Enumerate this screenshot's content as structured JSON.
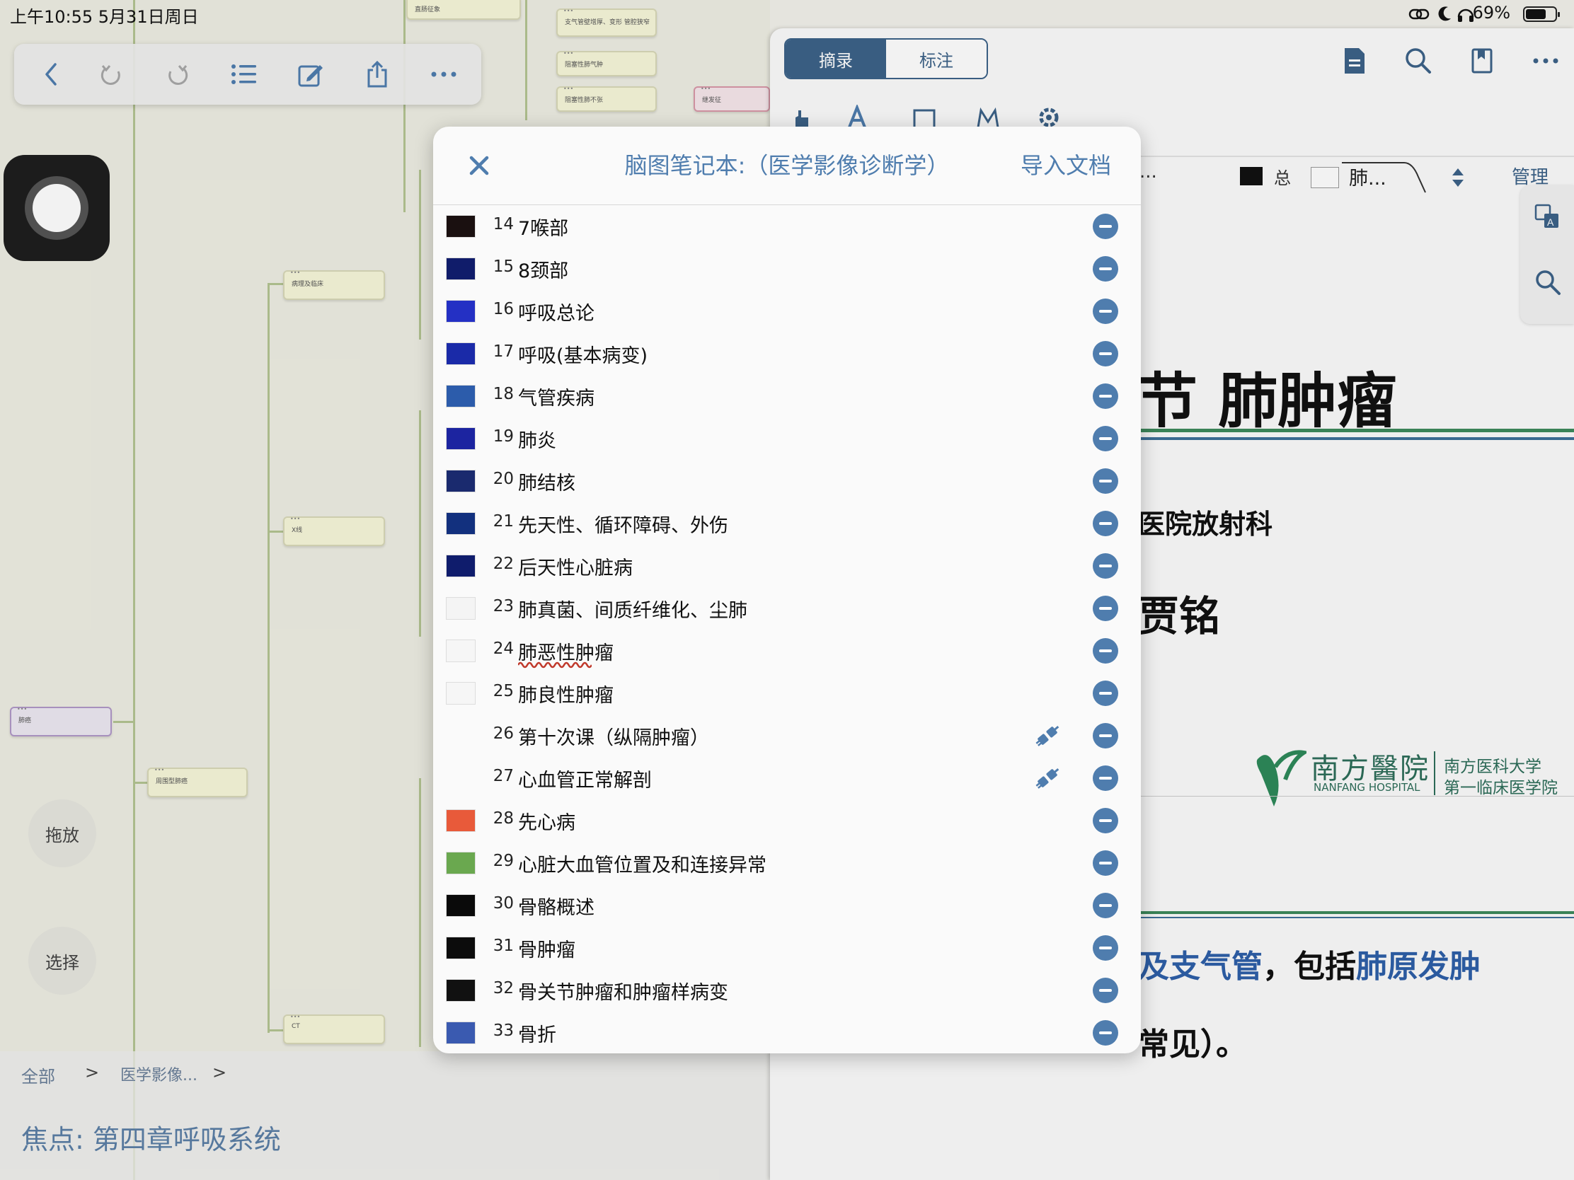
{
  "status_bar": {
    "time": "上午10:55  5月31日周日",
    "battery": "69%",
    "battery_level": 0.69
  },
  "left_pane": {
    "nodes": [
      "直肠征象",
      "支气管壁增厚、变形 管腔狭窄",
      "阻塞性肺气肿",
      "阻塞性肺不张",
      "继发征",
      "病理及临床",
      "X线",
      "肺癌",
      "周围型肺癌",
      "CT"
    ],
    "buttons": {
      "drag": "拖放",
      "select": "选择"
    },
    "breadcrumb": {
      "root": "全部",
      "sep1": ">",
      "item": "医学影像...",
      "sep2": ">"
    },
    "focus": "焦点:  第四章呼吸系统"
  },
  "right_pane": {
    "tabs": {
      "excerpt": "摘录",
      "annotate": "标注"
    },
    "doc_tabs": {
      "tab1": "...",
      "tab2": "总",
      "tab3": "肺...",
      "manage": "管理"
    },
    "doc": {
      "title": "节 肺肿瘤",
      "dept": "医院放射科",
      "author": "贾铭",
      "hospital_cn": "南方醫院",
      "hospital_en": "NANFANG HOSPITAL",
      "school_line1": "南方医科大学",
      "school_line2": "第一临床医学院",
      "body1_a": "及支气管",
      "body1_b": "，包括",
      "body1_c": "肺原发肿",
      "body2": "常见）。"
    },
    "colors": {
      "accent": "#3d6288",
      "green_rule": "#3e8a5c",
      "blue_rule": "#3e6f98"
    }
  },
  "modal": {
    "close_icon": "close-icon",
    "title": "脑图笔记本:（医学影像诊断学）",
    "import": "导入文档",
    "items": [
      {
        "num": "14",
        "label": "7喉部",
        "thumb": "#1a1010",
        "pinned": false
      },
      {
        "num": "15",
        "label": "8颈部",
        "thumb": "#101c6a",
        "pinned": false
      },
      {
        "num": "16",
        "label": "呼吸总论",
        "thumb": "#2430c4",
        "pinned": false
      },
      {
        "num": "17",
        "label": "呼吸(基本病变)",
        "thumb": "#1a2aa8",
        "pinned": false
      },
      {
        "num": "18",
        "label": "气管疾病",
        "thumb": "#2c5cab",
        "pinned": false
      },
      {
        "num": "19",
        "label": "肺炎",
        "thumb": "#1c24a0",
        "pinned": false
      },
      {
        "num": "20",
        "label": "肺结核",
        "thumb": "#1a2a6e",
        "pinned": false
      },
      {
        "num": "21",
        "label": "先天性、循环障碍、外伤",
        "thumb": "#12307e",
        "pinned": false
      },
      {
        "num": "22",
        "label": "后天性心脏病",
        "thumb": "#0f1c6c",
        "pinned": false
      },
      {
        "num": "23",
        "label": "肺真菌、间质纤维化、尘肺",
        "thumb": "#f4f4f4",
        "pinned": false
      },
      {
        "num": "24",
        "label": "肺恶性肿瘤",
        "thumb": "#f6f6f6",
        "pinned": false,
        "current": true
      },
      {
        "num": "25",
        "label": "肺良性肿瘤",
        "thumb": "#f6f6f6",
        "pinned": false
      },
      {
        "num": "26",
        "label": "第十次课（纵隔肿瘤）",
        "thumb": "",
        "pinned": true
      },
      {
        "num": "27",
        "label": "心血管正常解剖",
        "thumb": "",
        "pinned": true
      },
      {
        "num": "28",
        "label": "先心病",
        "thumb": "#e85a3a",
        "pinned": false
      },
      {
        "num": "29",
        "label": "心脏大血管位置及和连接异常",
        "thumb": "#6aa84f",
        "pinned": false
      },
      {
        "num": "30",
        "label": "骨骼概述",
        "thumb": "#0a0a0a",
        "pinned": false
      },
      {
        "num": "31",
        "label": "骨肿瘤",
        "thumb": "#0c0c0c",
        "pinned": false
      },
      {
        "num": "32",
        "label": "骨关节肿瘤和肿瘤样病变",
        "thumb": "#111111",
        "pinned": false
      },
      {
        "num": "33",
        "label": "骨折",
        "thumb": "#3a5ab0",
        "pinned": false
      }
    ]
  }
}
